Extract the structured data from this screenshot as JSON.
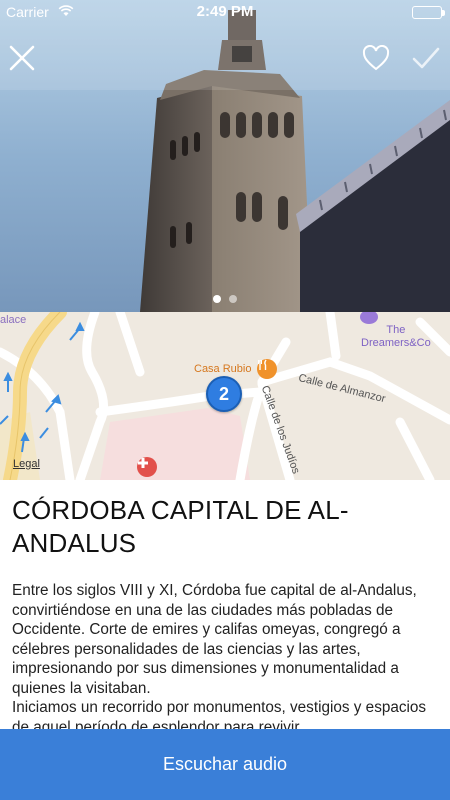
{
  "status_bar": {
    "carrier": "Carrier",
    "time": "2:49 PM",
    "battery_color": "#5fd35f"
  },
  "header": {
    "close_icon": "close-icon",
    "favorite_icon": "heart-outline-icon",
    "done_icon": "checkmark-icon"
  },
  "gallery": {
    "page_count": 2,
    "current_page": 1
  },
  "map": {
    "place_labels": {
      "palace": "alace",
      "dreamers": "The\nDreamers&Co",
      "casa_rubio": "Casa Rubio",
      "calle_almanzor": "Calle de Almanzor",
      "calle_judios": "Calle de los Judíos",
      "legal": "Legal"
    },
    "stop_number": "2",
    "pin_color": "#2f7de1"
  },
  "content": {
    "title": "CÓRDOBA CAPITAL DE AL-ANDALUS",
    "paragraphs": [
      "Entre los siglos VIII y XI, Córdoba fue capital de al-Andalus, convirtiéndose en una de las ciudades más pobladas de Occidente. Corte de emires y califas omeyas, congregó a célebres personalidades de las ciencias y las artes, impresionando por sus dimensiones y monumentalidad a quienes la visitaban.",
      "Iniciamos un recorrido por monumentos, vestigios y espacios de aquel período de esplendor para revivir"
    ]
  },
  "footer": {
    "audio_button_label": "Escuchar audio",
    "accent_color": "#3a7fd8"
  }
}
